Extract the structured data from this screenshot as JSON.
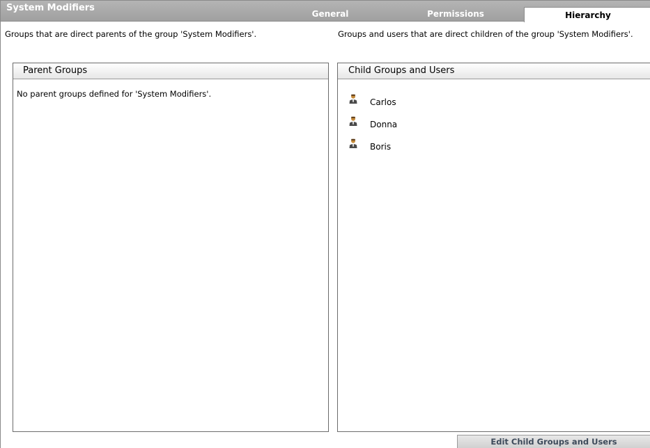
{
  "header": {
    "title": "System Modifiers",
    "tabs": [
      {
        "label": "General",
        "active": false
      },
      {
        "label": "Permissions",
        "active": false
      },
      {
        "label": "Hierarchy",
        "active": true
      }
    ]
  },
  "parents": {
    "description": "Groups that are direct parents of the group 'System Modifiers'.",
    "panel_title": "Parent Groups",
    "empty_message": "No parent groups defined for 'System Modifiers'."
  },
  "children": {
    "description": "Groups and users that are direct children of the group 'System Modifiers'.",
    "panel_title": "Child Groups and Users",
    "items": [
      {
        "label": "Carlos",
        "icon": "user-icon"
      },
      {
        "label": "Donna",
        "icon": "user-icon"
      },
      {
        "label": "Boris",
        "icon": "user-icon"
      }
    ]
  },
  "footer": {
    "edit_button_label": "Edit Child Groups and Users"
  },
  "colors": {
    "header_bg": "#a8a8a8",
    "tab_text": "#ffffff",
    "button_text": "#3d4a5a"
  }
}
